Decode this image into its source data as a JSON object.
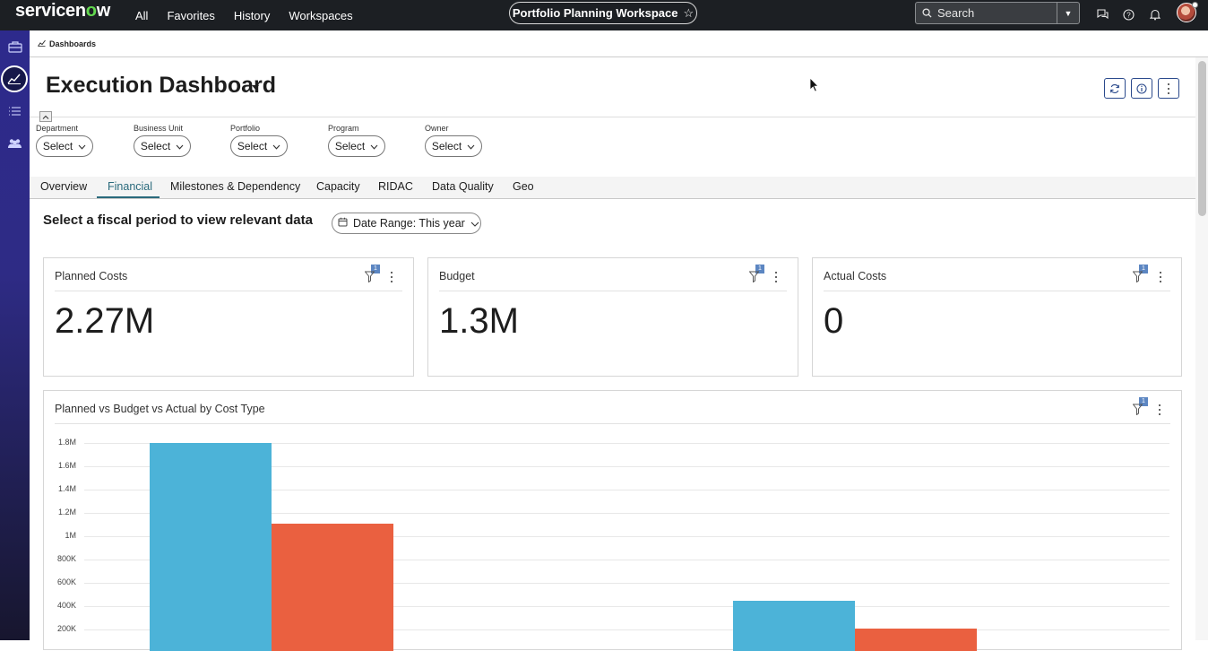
{
  "topnav": {
    "logo_text": "servicenow",
    "links": [
      "All",
      "Favorites",
      "History",
      "Workspaces"
    ],
    "workspace": "Portfolio Planning Workspace",
    "search_placeholder": "Search"
  },
  "breadcrumb": "Dashboards",
  "dashboard": {
    "title": "Execution Dashboard"
  },
  "filters": [
    {
      "label": "Department",
      "value": "Select"
    },
    {
      "label": "Business Unit",
      "value": "Select"
    },
    {
      "label": "Portfolio",
      "value": "Select"
    },
    {
      "label": "Program",
      "value": "Select"
    },
    {
      "label": "Owner",
      "value": "Select"
    }
  ],
  "tabs": [
    "Overview",
    "Financial",
    "Milestones & Dependency",
    "Capacity",
    "RIDAC",
    "Data Quality",
    "Geo"
  ],
  "active_tab": "Financial",
  "fiscal_prompt": "Select a fiscal period to view relevant data",
  "date_range": "Date Range: This year",
  "cards": [
    {
      "title": "Planned Costs",
      "value": "2.27M",
      "filter_count": "1"
    },
    {
      "title": "Budget",
      "value": "1.3M",
      "filter_count": "1"
    },
    {
      "title": "Actual Costs",
      "value": "0",
      "filter_count": "1"
    }
  ],
  "chart_card": {
    "title": "Planned vs Budget vs Actual by Cost Type",
    "filter_count": "1"
  },
  "chart_data": {
    "type": "bar",
    "title": "Planned vs Budget vs Actual by Cost Type",
    "y_ticks": [
      "1.8M",
      "1.6M",
      "1.4M",
      "1.2M",
      "1M",
      "800K",
      "600K",
      "400K",
      "200K"
    ],
    "ylim_visible": [
      200000,
      1800000
    ],
    "groups": [
      {
        "bars": [
          {
            "color": "#4cb3d8",
            "value": 1800000
          },
          {
            "color": "#ea6040",
            "value": 1110000
          }
        ]
      },
      {
        "bars": [
          {
            "color": "#4cb3d8",
            "value": 450000
          },
          {
            "color": "#ea6040",
            "value": 210000
          }
        ]
      }
    ]
  },
  "colors": {
    "planned": "#4cb3d8",
    "budget": "#ea6040",
    "accent": "#2a6a7c"
  }
}
